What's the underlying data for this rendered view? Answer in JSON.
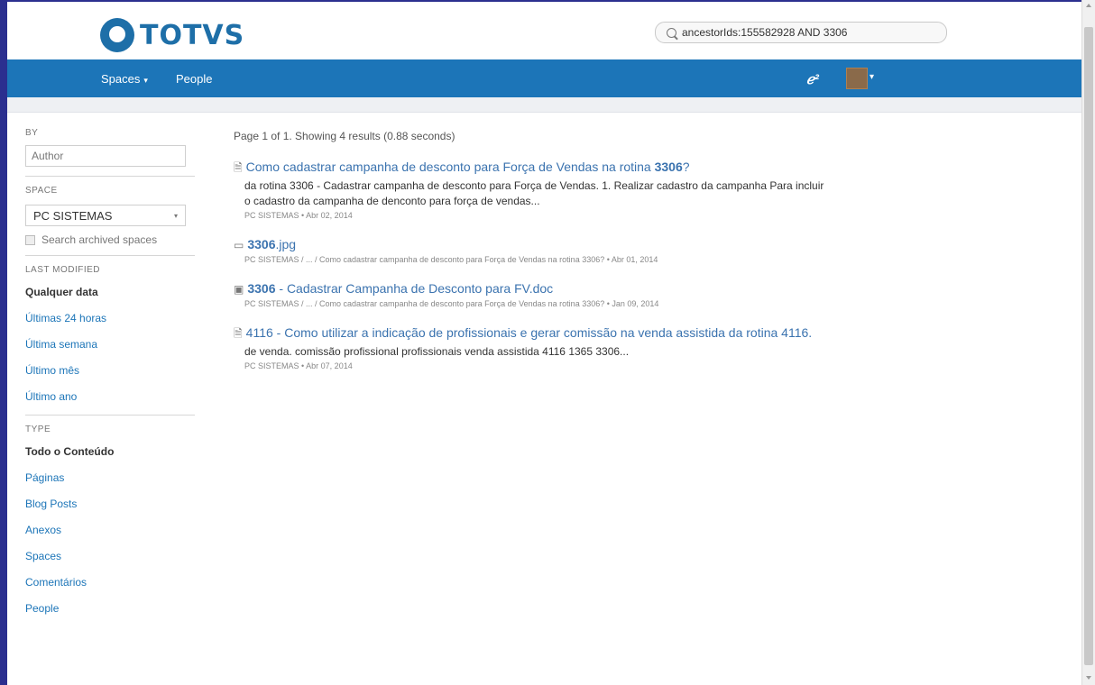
{
  "header": {
    "logo_text": "TOTVS",
    "search_value": "ancestorIds:155582928 AND 3306"
  },
  "nav": {
    "spaces": "Spaces",
    "people": "People"
  },
  "sidebar": {
    "by_heading": "BY",
    "author_placeholder": "Author",
    "space_heading": "SPACE",
    "space_selected": "PC SISTEMAS",
    "archived_label": "Search archived spaces",
    "last_modified_heading": "LAST MODIFIED",
    "last_modified_options": [
      "Qualquer data",
      "Últimas 24 horas",
      "Última semana",
      "Último mês",
      "Último ano"
    ],
    "type_heading": "TYPE",
    "type_options": [
      "Todo o Conteúdo",
      "Páginas",
      "Blog Posts",
      "Anexos",
      "Spaces",
      "Comentários",
      "People"
    ]
  },
  "results": {
    "summary": "Page 1 of 1. Showing 4 results (0.88 seconds)",
    "items": [
      {
        "icon": "page-icon",
        "title_pre": "Como cadastrar campanha de desconto para Força de Vendas na rotina ",
        "title_bold": "3306",
        "title_post": "?",
        "excerpt": "da rotina 3306 - Cadastrar campanha de desconto para Força de Vendas. 1. Realizar cadastro da campanha Para incluir o cadastro da campanha de denconto para força de vendas...",
        "meta": "PC SISTEMAS • Abr 02, 2014"
      },
      {
        "icon": "image-icon",
        "title_pre": "",
        "title_bold": "3306",
        "title_post": ".jpg",
        "excerpt": "",
        "meta": "PC SISTEMAS / ... / Como cadastrar campanha de desconto para Força de Vendas na rotina 3306? • Abr 01, 2014"
      },
      {
        "icon": "word-doc-icon",
        "title_pre": "",
        "title_bold": "3306",
        "title_post": " - Cadastrar Campanha de Desconto para FV.doc",
        "excerpt": "",
        "meta": "PC SISTEMAS / ... / Como cadastrar campanha de desconto para Força de Vendas na rotina 3306? • Jan 09, 2014"
      },
      {
        "icon": "page-icon",
        "title_pre": "4116 - Como utilizar a indicação de profissionais e gerar comissão na venda assistida da rotina 4116.",
        "title_bold": "",
        "title_post": "",
        "excerpt": "de venda. comissão profissional profissionais venda assistida 4116 1365 3306...",
        "meta": "PC SISTEMAS • Abr 07, 2014"
      }
    ]
  }
}
